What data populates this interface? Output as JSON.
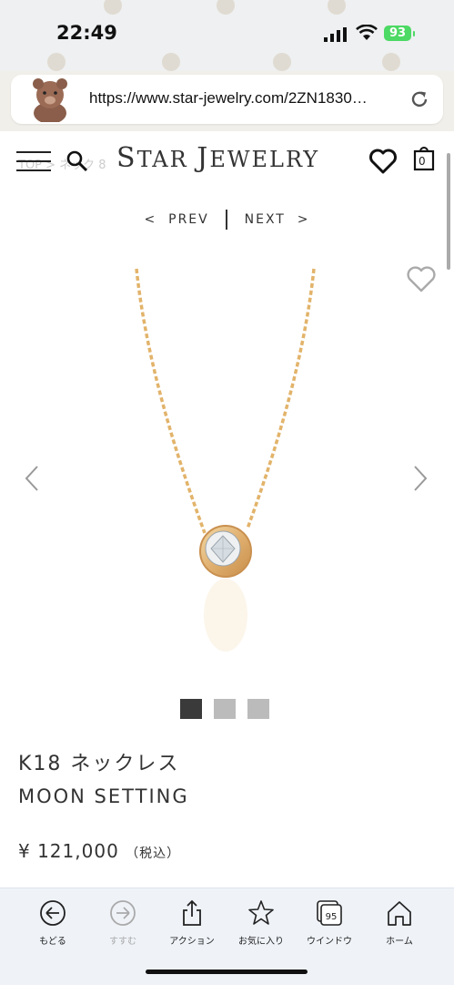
{
  "status_bar": {
    "time": "22:49",
    "battery": "93"
  },
  "browser": {
    "url": "https://www.star-jewelry.com/2ZN1830…"
  },
  "site": {
    "logo_first": "S",
    "logo_rest1": "TAR ",
    "logo_j": "J",
    "logo_rest2": "EWELRY",
    "breadcrumb": "TOP > ネック  8",
    "cart_count": "0"
  },
  "pager": {
    "prev": "PREV",
    "next": "NEXT"
  },
  "product": {
    "name_jp": "K18 ネックレス",
    "name_en": "MOON SETTING",
    "price": "¥ 121,000",
    "tax_note": "（税込）",
    "image_count": 3
  },
  "toolbar": {
    "back": "もどる",
    "forward": "すすむ",
    "action": "アクション",
    "bookmarks": "お気に入り",
    "windows": "ウインドウ",
    "windows_count": "95",
    "home": "ホーム"
  }
}
